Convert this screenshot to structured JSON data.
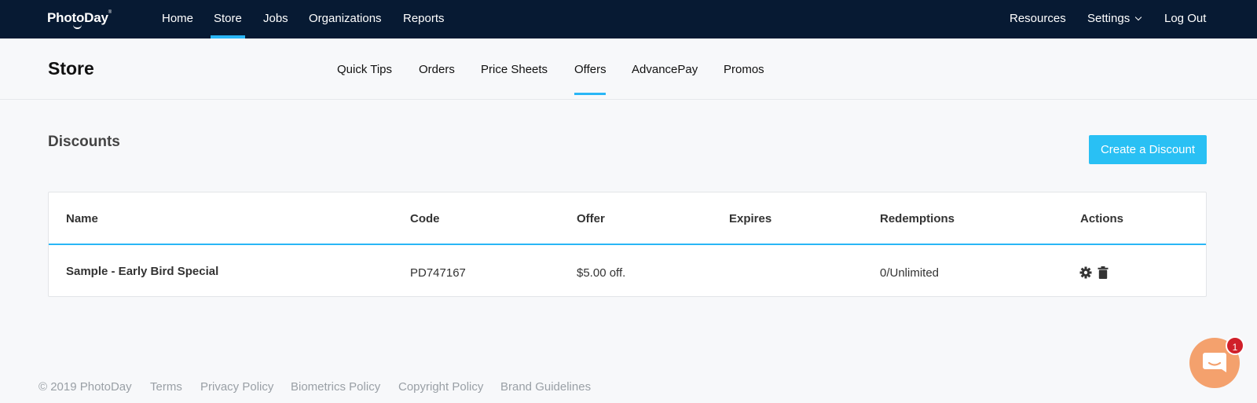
{
  "brand": {
    "name": "PhotoDay"
  },
  "topnav": {
    "items": [
      {
        "label": "Home"
      },
      {
        "label": "Store"
      },
      {
        "label": "Jobs"
      },
      {
        "label": "Organizations"
      },
      {
        "label": "Reports"
      }
    ],
    "active": "Store",
    "right": {
      "resources": "Resources",
      "settings": "Settings",
      "logout": "Log Out"
    }
  },
  "subheader": {
    "title": "Store",
    "tabs": [
      {
        "label": "Quick Tips"
      },
      {
        "label": "Orders"
      },
      {
        "label": "Price Sheets"
      },
      {
        "label": "Offers"
      },
      {
        "label": "AdvancePay"
      },
      {
        "label": "Promos"
      }
    ],
    "active": "Offers"
  },
  "discounts": {
    "title": "Discounts",
    "create_label": "Create a Discount",
    "columns": [
      "Name",
      "Code",
      "Offer",
      "Expires",
      "Redemptions",
      "Actions"
    ],
    "rows": [
      {
        "name": "Sample - Early Bird Special",
        "code": "PD747167",
        "offer": "$5.00 off.",
        "expires": "",
        "redemptions": "0/Unlimited"
      }
    ]
  },
  "footer": {
    "copyright": "© 2019 PhotoDay",
    "links": [
      "Terms",
      "Privacy Policy",
      "Biometrics Policy",
      "Copyright Policy",
      "Brand Guidelines"
    ]
  },
  "chat": {
    "badge_count": "1"
  },
  "colors": {
    "nav_bg": "#071a33",
    "accent": "#29b6f6",
    "button": "#29c0f4",
    "chat": "#f4a16d",
    "badge": "#d0202a"
  }
}
